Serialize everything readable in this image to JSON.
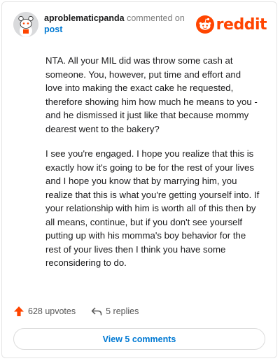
{
  "comment": {
    "username": "aproblematicpanda",
    "action_text": "commented on",
    "post_link": "post",
    "paragraphs": [
      "NTA. All your MIL did was throw some cash at someone. You, however, put time and effort and love into making the exact cake he requested, therefore showing him how much he means to you - and he dismissed it just like that because mommy dearest went to the bakery?",
      "I see you're engaged. I hope you realize that this is exactly how it's going to be for the rest of your lives and I hope you know that by marrying him, you realize that this is what you're getting yourself into. If your relationship with him is worth all of this then by all means, continue, but if you don't see yourself putting up with his momma's boy behavior for the rest of your lives then I think you have some reconsidering to do."
    ]
  },
  "brand": {
    "logo_text": "reddit",
    "color": "#ff4500"
  },
  "actions": {
    "upvotes_label": "628 upvotes",
    "replies_label": "5 replies",
    "upvote_icon": "upvote-arrow-icon",
    "reply_icon": "reply-arrow-icon"
  },
  "footer": {
    "view_comments_label": "View 5 comments"
  },
  "colors": {
    "accent": "#ff4500",
    "link": "#0079d3"
  }
}
